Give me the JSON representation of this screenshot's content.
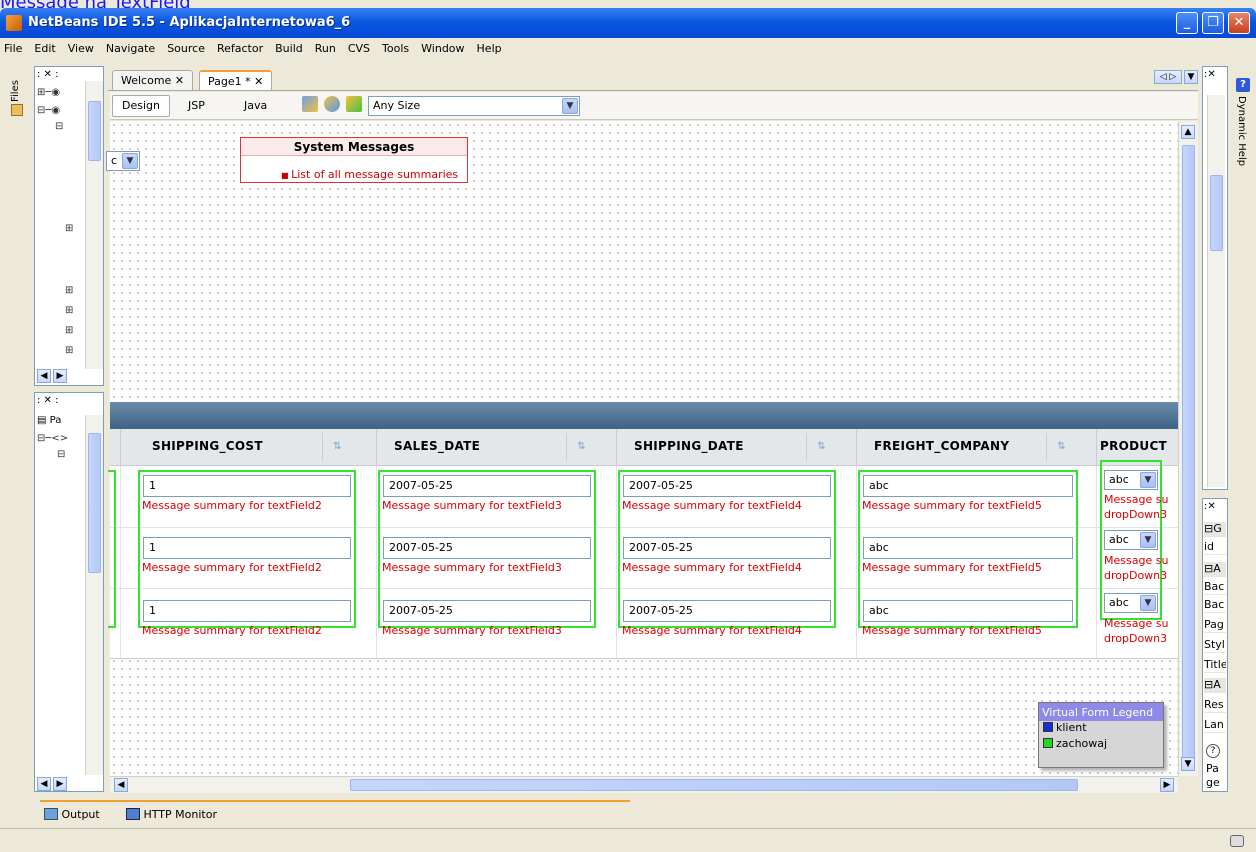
{
  "caption": "Message na TextField",
  "window": {
    "title": "NetBeans IDE 5.5 - AplikacjaInternetowa6_6",
    "min": "_",
    "max": "❐",
    "close": "✕"
  },
  "menu": [
    "File",
    "Edit",
    "View",
    "Navigate",
    "Source",
    "Refactor",
    "Build",
    "Run",
    "CVS",
    "Tools",
    "Window",
    "Help"
  ],
  "left_side_tab": "Files",
  "editor_tabs": [
    {
      "label": "Welcome",
      "close": "✕"
    },
    {
      "label": "Page1 *",
      "close": "✕"
    }
  ],
  "editor_toolbar": {
    "design": "Design",
    "jsp": "JSP",
    "java": "Java",
    "size": "Any Size"
  },
  "system_messages": {
    "title": "System Messages",
    "item": "List of all message summaries"
  },
  "first_dropdown_value": "c",
  "columns": [
    {
      "title": "SHIPPING_COST",
      "sort": "⇅"
    },
    {
      "title": "SALES_DATE",
      "sort": "⇅"
    },
    {
      "title": "SHIPPING_DATE",
      "sort": "⇅"
    },
    {
      "title": "FREIGHT_COMPANY",
      "sort": "⇅"
    },
    {
      "title": "PRODUCT",
      "sort": ""
    }
  ],
  "rows": [
    {
      "cells": [
        "1",
        "2007-05-25",
        "2007-05-25",
        "abc"
      ],
      "msgs": [
        "Message summary for textField2",
        "Message summary for textField3",
        "Message summary for textField4",
        "Message summary for textField5"
      ],
      "dd": "abc",
      "dd_msg1": "Message su",
      "dd_msg2": "dropDown3"
    },
    {
      "cells": [
        "1",
        "2007-05-25",
        "2007-05-25",
        "abc"
      ],
      "msgs": [
        "Message summary for textField2",
        "Message summary for textField3",
        "Message summary for textField4",
        "Message summary for textField5"
      ],
      "dd": "abc",
      "dd_msg1": "Message su",
      "dd_msg2": "dropDown3"
    },
    {
      "cells": [
        "1",
        "2007-05-25",
        "2007-05-25",
        "abc"
      ],
      "msgs": [
        "Message summary for textField2",
        "Message summary for textField3",
        "Message summary for textField4",
        "Message summary for textField5"
      ],
      "dd": "abc",
      "dd_msg1": "Message su",
      "dd_msg2": "dropDown3"
    }
  ],
  "legend": {
    "title": "Virtual Form Legend",
    "items": [
      {
        "label": "klient",
        "color": "#1a2bd8"
      },
      {
        "label": "zachowaj",
        "color": "#22d822"
      }
    ]
  },
  "right_panel": {
    "dynamic_help": "Dynamic Help",
    "props": [
      "G",
      "id",
      "A",
      "Bac",
      "Bac",
      "Pag",
      "Styl",
      "Title",
      "A",
      "Res",
      "Lan"
    ],
    "help_line1": "Pa",
    "help_line2": "ge"
  },
  "left_bottom_panel": {
    "label": "Pa"
  },
  "bottom_tabs": {
    "output": "Output",
    "http": "HTTP Monitor"
  }
}
